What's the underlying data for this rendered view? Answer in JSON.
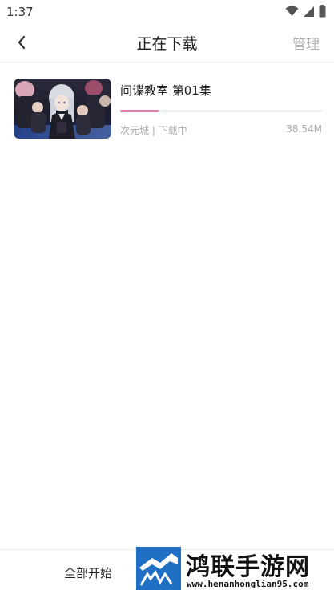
{
  "status_bar": {
    "time": "1:37",
    "icons": [
      "wifi-icon",
      "cell-signal-icon",
      "battery-icon"
    ]
  },
  "header": {
    "back_icon": "chevron-left-icon",
    "title": "正在下载",
    "manage_label": "管理"
  },
  "downloads": [
    {
      "title": "间谍教室 第01集",
      "meta": "次元城 | 下载中",
      "size": "38.54M",
      "progress": 0.19
    }
  ],
  "bottom_bar": {
    "start_all_label": "全部开始"
  },
  "watermark": {
    "name": "鸿联手游网",
    "url": "www.henanhonglian95.com"
  },
  "colors": {
    "progress_fill": "#e07aa8",
    "progress_track": "#eeeeee",
    "muted_text": "#aaaaaa",
    "watermark_blue": "#1f6fc4"
  }
}
